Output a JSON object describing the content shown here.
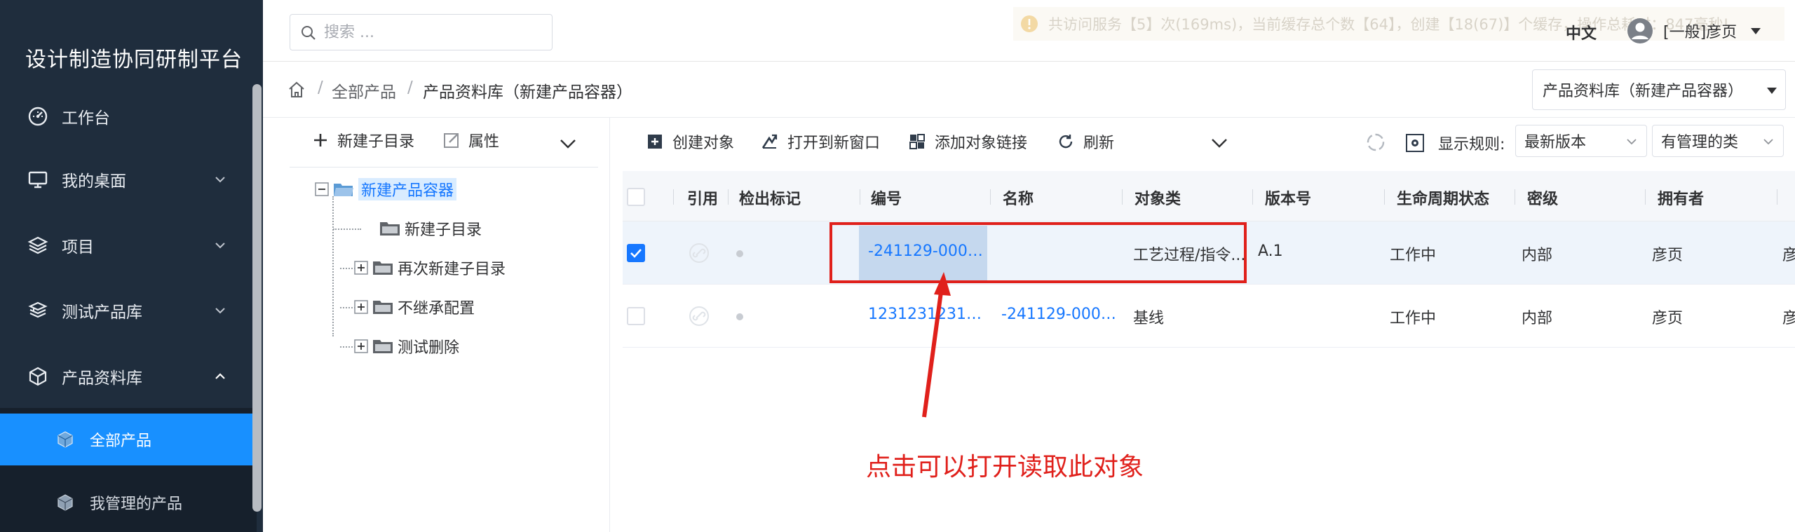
{
  "app": {
    "title": "设计制造协同研制平台"
  },
  "sidebar": {
    "items": [
      {
        "label": "工作台",
        "icon": "dashboard-icon"
      },
      {
        "label": "我的桌面",
        "icon": "monitor-icon"
      },
      {
        "label": "项目",
        "icon": "layers-icon"
      },
      {
        "label": "测试产品库",
        "icon": "stack-icon"
      },
      {
        "label": "产品资料库",
        "icon": "cube-icon"
      }
    ],
    "sub_items": [
      {
        "label": "全部产品",
        "icon": "cube-small-icon",
        "active": true
      },
      {
        "label": "我管理的产品",
        "icon": "cube-small-icon",
        "active": false
      }
    ]
  },
  "header": {
    "search_placeholder": "搜索 ...",
    "notice": "共访问服务【5】次(169ms)，当前缓存总个数【64】，创建【18(67)】个缓存，操作总耗时：847毫秒!",
    "language": "中文",
    "user": "[一般]彦页"
  },
  "breadcrumb": {
    "items": [
      "全部产品",
      "产品资料库（新建产品容器）"
    ],
    "separator": "/",
    "container_select": "产品资料库（新建产品容器）"
  },
  "tree": {
    "toolbar": {
      "new_folder": "新建子目录",
      "properties": "属性"
    },
    "root": "新建产品容器",
    "children": [
      "新建子目录",
      "再次新建子目录",
      "不继承配置",
      "测试删除"
    ]
  },
  "toolbar": {
    "create": "创建对象",
    "open_new_window": "打开到新窗口",
    "add_link": "添加对象链接",
    "refresh": "刷新",
    "display_rule_label": "显示规则:",
    "version_select": "最新版本",
    "class_select": "有管理的类"
  },
  "table": {
    "headers": [
      "引用",
      "检出标记",
      "编号",
      "名称",
      "对象类",
      "版本号",
      "生命周期状态",
      "密级",
      "拥有者"
    ],
    "rows": [
      {
        "checked": true,
        "number": "-241129-0000...",
        "name": "",
        "object_class": "工艺过程/指令...",
        "version": "A.1",
        "state": "工作中",
        "secret": "内部",
        "owner": "彦页",
        "extra": "彦"
      },
      {
        "checked": false,
        "number": "12312312312...",
        "name": "-241129-0000...",
        "object_class": "基线",
        "version": "",
        "state": "工作中",
        "secret": "内部",
        "owner": "彦页",
        "extra": "彦"
      }
    ]
  },
  "annotation": {
    "text": "点击可以打开读取此对象",
    "color": "#e0201b"
  },
  "colors": {
    "sidebar_bg": "#1f2d3d",
    "accent": "#1890ff",
    "link": "#1677ff"
  }
}
